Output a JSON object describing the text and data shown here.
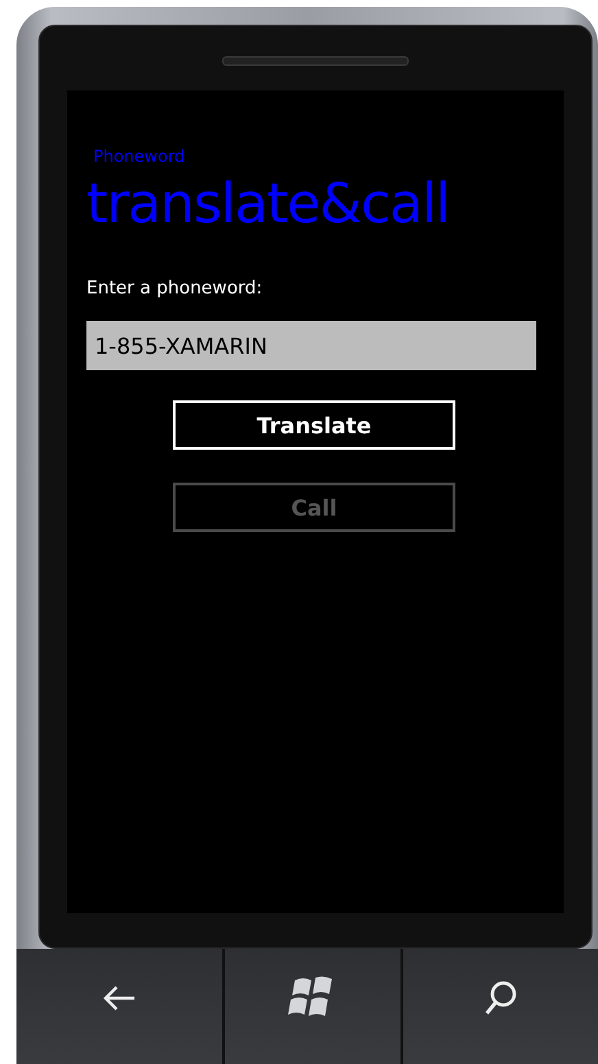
{
  "app_title": "Phoneword",
  "page_title": "translate&call",
  "prompt": "Enter a phoneword:",
  "phoneword_field": {
    "value": "1-855-XAMARIN"
  },
  "buttons": [
    {
      "label": "Translate",
      "disabled": false
    },
    {
      "label": "Call",
      "disabled": true
    }
  ]
}
